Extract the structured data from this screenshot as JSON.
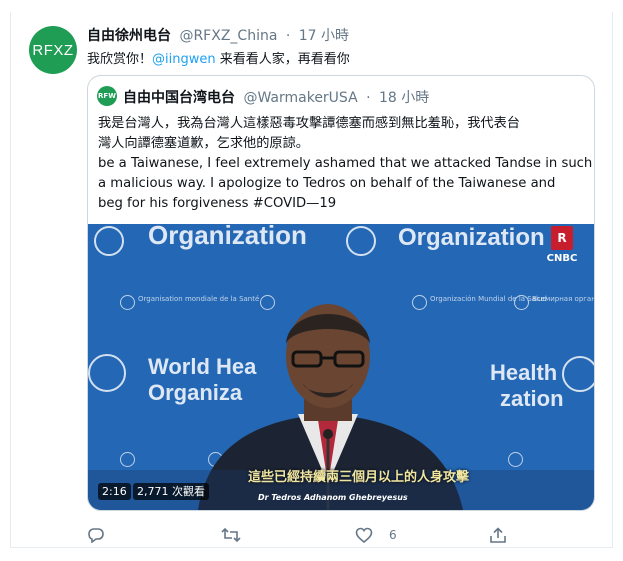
{
  "tweet": {
    "avatar_text": "RFXZ",
    "display_name": "自由徐州电台",
    "handle": "@RFXZ_China",
    "separator": "·",
    "time": "17 小時",
    "text_before": "我欣赏你！",
    "mention": "@iingwen",
    "text_after": " 来看看人家，再看看你"
  },
  "quote": {
    "avatar_text": "RFW",
    "display_name": "自由中国台湾电台",
    "handle": "@WarmakerUSA",
    "separator": "·",
    "time": "18 小時",
    "lines": [
      "我是台灣人，我為台灣人這樣惡毒攻擊譚德塞而感到無比羞恥，我代表台",
      "灣人向譚德塞道歉，乞求他的原諒。",
      "be a Taiwanese, I feel extremely ashamed that we attacked Tandse in such",
      "a malicious way. I apologize to Tedros on behalf of the Taiwanese and",
      "beg for his forgiveness  #COVID—19"
    ]
  },
  "video": {
    "bg_text_1": "Organization",
    "bg_text_2": "Organization",
    "bg_text_3": "World Hea",
    "bg_text_4": "Organiza",
    "bg_text_5": "Health",
    "bg_text_6": "zation",
    "subtitle": "這些已經持續兩三個月以上的人身攻擊",
    "speaker_name": "Dr Tedros Adhanom Ghebreyesus",
    "channel_logo": "CNBC",
    "duration": "2:16",
    "views": "2,771 次觀看"
  },
  "actions": {
    "reply_count": "",
    "retweet_count": "",
    "like_count": "6"
  },
  "colors": {
    "accent": "#1da1f2",
    "avatar_green": "#1f9d55",
    "video_blue": "#2467b5"
  }
}
